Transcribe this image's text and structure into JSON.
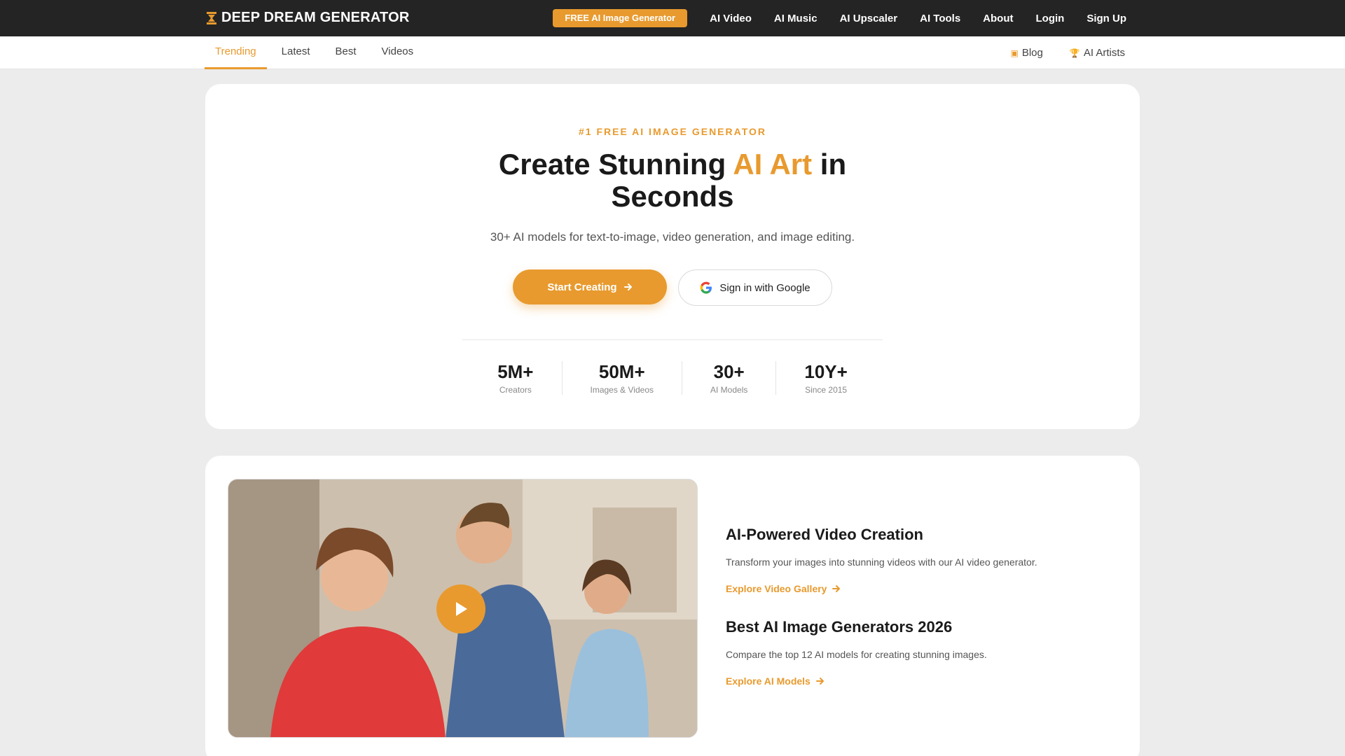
{
  "topnav": {
    "brand": "DEEP DREAM GENERATOR",
    "free_button": "FREE AI Image Generator",
    "links": [
      "AI Video",
      "AI Music",
      "AI Upscaler",
      "AI Tools",
      "About",
      "Login",
      "Sign Up"
    ]
  },
  "subnav": {
    "tabs": [
      "Trending",
      "Latest",
      "Best",
      "Videos"
    ],
    "active_tab": "Trending",
    "blog": "Blog",
    "artists": "AI Artists"
  },
  "hero": {
    "eyebrow": "#1 FREE AI IMAGE GENERATOR",
    "title_pre": "Create Stunning ",
    "title_accent": "AI Art",
    "title_post": " in Seconds",
    "subtitle": "30+ AI models for text-to-image, video generation, and image editing.",
    "start_button": "Start Creating",
    "google_button": "Sign in with Google",
    "stats": [
      {
        "value": "5M+",
        "label": "Creators"
      },
      {
        "value": "50M+",
        "label": "Images & Videos"
      },
      {
        "value": "30+",
        "label": "AI Models"
      },
      {
        "value": "10Y+",
        "label": "Since 2015"
      }
    ]
  },
  "feature": {
    "video_heading": "AI-Powered Video Creation",
    "video_text": "Transform your images into stunning videos with our AI video generator.",
    "video_link": "Explore Video Gallery",
    "models_heading": "Best AI Image Generators 2026",
    "models_text": "Compare the top 12 AI models for creating stunning images.",
    "models_link": "Explore AI Models"
  },
  "colors": {
    "accent": "#e89a2e",
    "nav_bg": "#242424",
    "page_bg": "#ececec"
  },
  "icons": {
    "brand": "hourglass-logo-icon",
    "blog": "book-icon",
    "artists": "trophy-icon",
    "arrow": "arrow-right-icon",
    "google": "google-g-icon",
    "play": "play-icon"
  }
}
